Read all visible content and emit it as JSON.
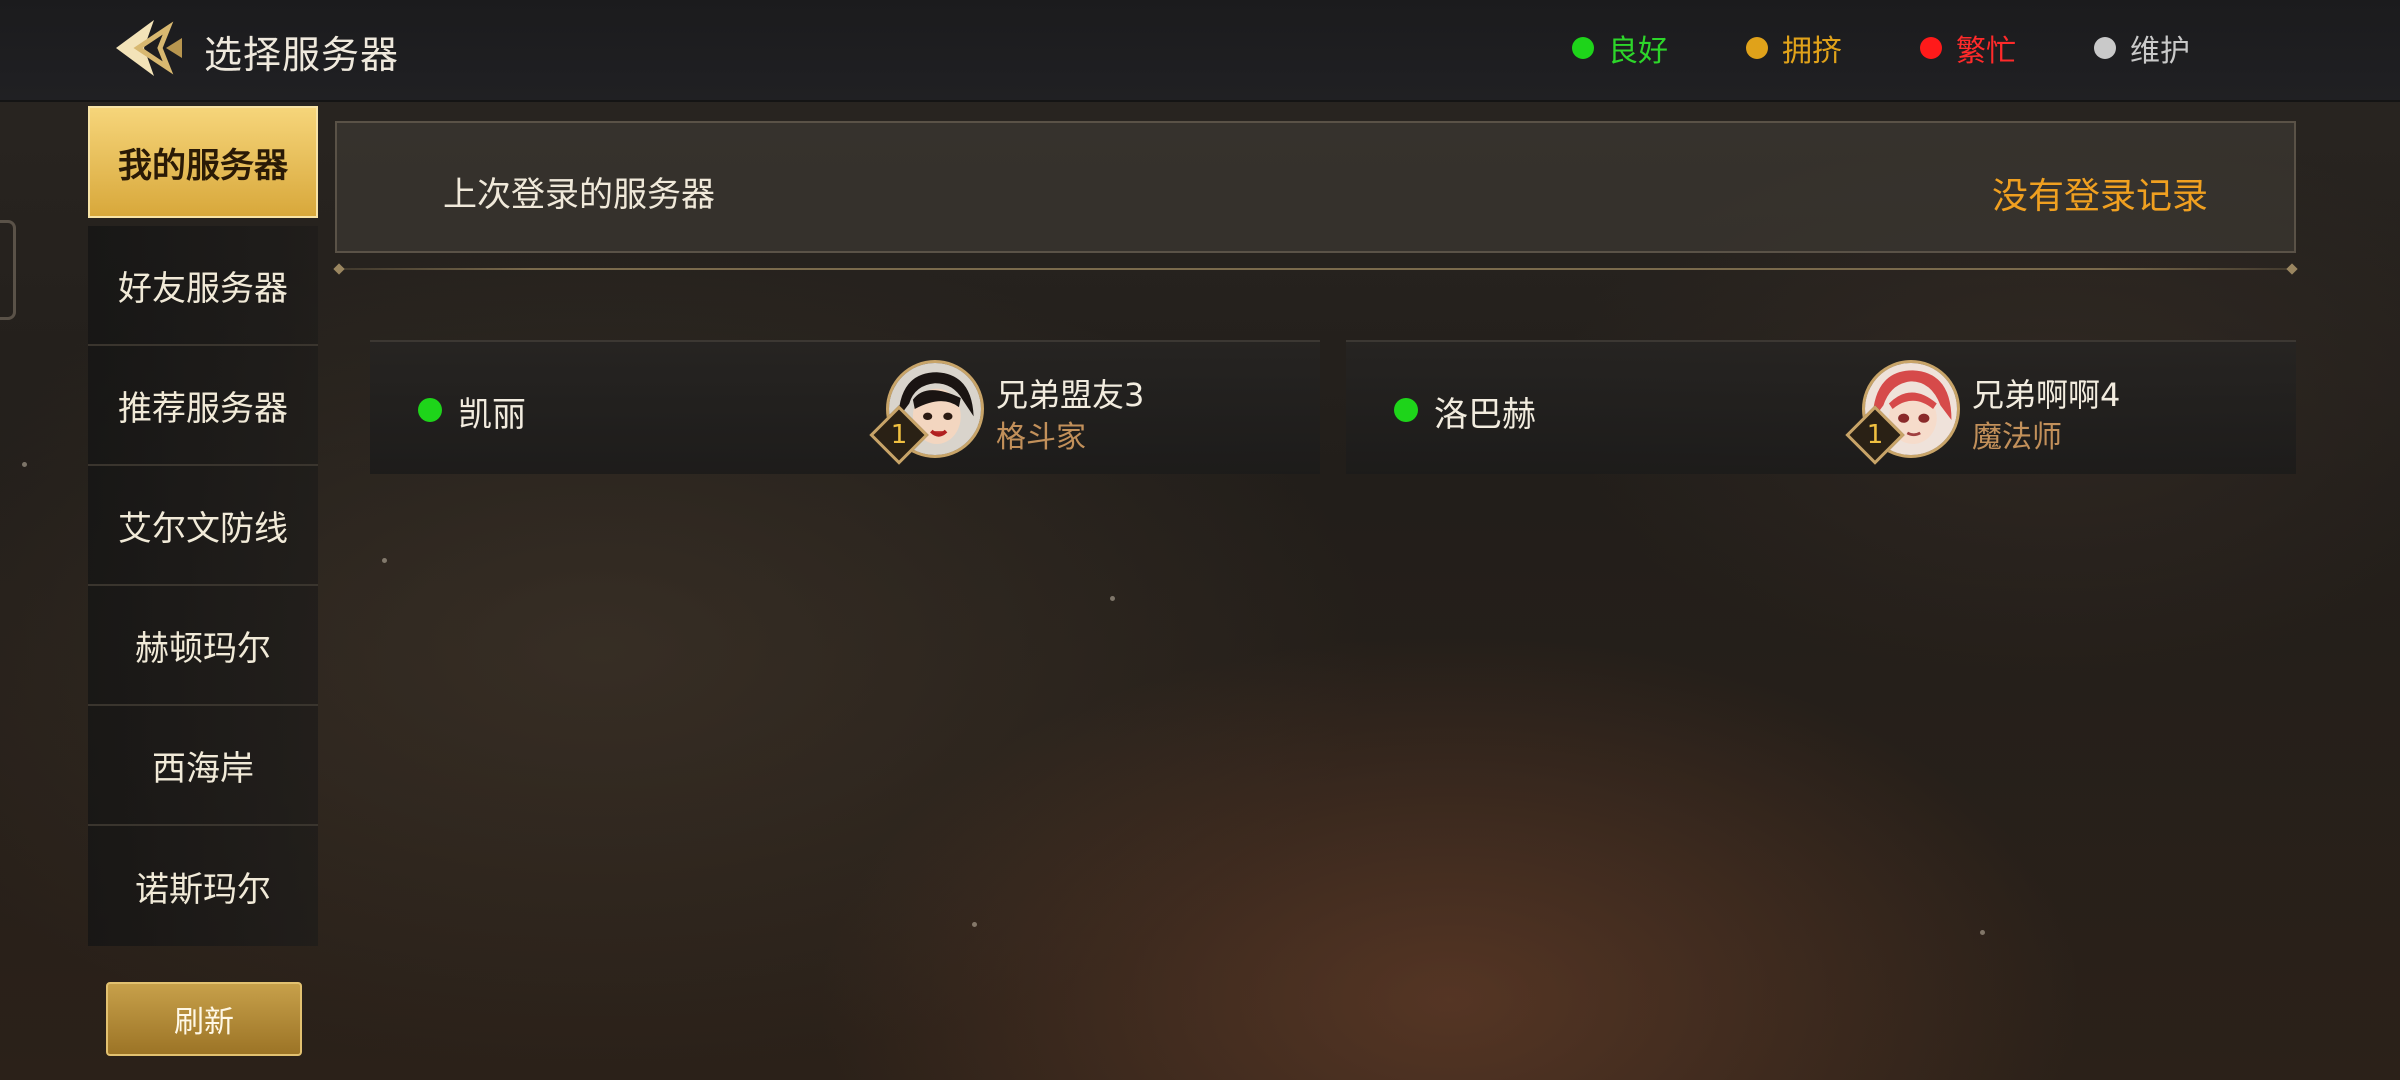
{
  "header": {
    "title": "选择服务器",
    "legend": [
      {
        "label": "良好",
        "color": "#2dd62a"
      },
      {
        "label": "拥挤",
        "color": "#e0a21a"
      },
      {
        "label": "繁忙",
        "color": "#ff2a2a"
      },
      {
        "label": "维护",
        "color": "#c9c9c9"
      }
    ]
  },
  "sidebar": {
    "items": [
      {
        "label": "我的服务器",
        "active": true
      },
      {
        "label": "好友服务器"
      },
      {
        "label": "推荐服务器"
      },
      {
        "label": "艾尔文防线"
      },
      {
        "label": "赫顿玛尔"
      },
      {
        "label": "西海岸"
      },
      {
        "label": "诺斯玛尔"
      }
    ],
    "refresh_label": "刷新"
  },
  "last_login": {
    "title": "上次登录的服务器",
    "status": "没有登录记录"
  },
  "servers": [
    {
      "name": "凯丽",
      "status_color": "#1ed41a",
      "character": {
        "name": "兄弟盟友3",
        "class": "格斗家",
        "level": "1",
        "avatar_icon": "character-portrait-icon"
      }
    },
    {
      "name": "洛巴赫",
      "status_color": "#1ed41a",
      "character": {
        "name": "兄弟啊啊4",
        "class": "魔法师",
        "level": "1",
        "avatar_icon": "character-portrait-icon"
      }
    }
  ]
}
